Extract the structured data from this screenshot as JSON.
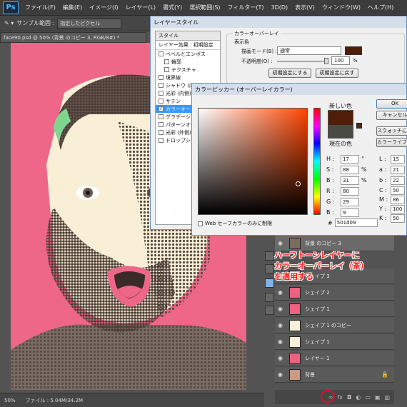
{
  "app": {
    "logo": "Ps",
    "menu": [
      "ファイル(F)",
      "編集(E)",
      "イメージ(I)",
      "レイヤー(L)",
      "書式(Y)",
      "選択範囲(S)",
      "フィルター(T)",
      "3D(D)",
      "表示(V)",
      "ウィンドウ(W)",
      "ヘルプ(H)"
    ]
  },
  "options": {
    "sample_label": "サンプル範囲 :",
    "sample_value": "指定したピクセル"
  },
  "document": {
    "tab": "face90.psd @ 50% (背景 のコピー 3, RGB/8#) *",
    "zoom": "50%",
    "file_info": "ファイル : 5.04M/34.2M"
  },
  "layer_style": {
    "title": "レイヤースタイル",
    "style_header": "スタイル",
    "preset": "レイヤー効果 : 初期設定",
    "effects": [
      {
        "label": "ベベルとエンボス",
        "checked": false
      },
      {
        "label": "輪郭",
        "checked": false
      },
      {
        "label": "テクスチャ",
        "checked": false
      },
      {
        "label": "境界線",
        "checked": false
      },
      {
        "label": "シャドウ (内側)",
        "checked": false
      },
      {
        "label": "光彩 (内側)",
        "checked": false
      },
      {
        "label": "サテン",
        "checked": false
      },
      {
        "label": "カラーオーバーレイ",
        "checked": true
      },
      {
        "label": "グラデーションオーバーレイ",
        "checked": false
      },
      {
        "label": "パターンオーバーレイ",
        "checked": false
      },
      {
        "label": "光彩 (外側)",
        "checked": false
      },
      {
        "label": "ドロップシャドウ",
        "checked": false
      }
    ],
    "group_title": "カラーオーバーレイ",
    "sub_title": "表示色",
    "blend_label": "描画モード(B) :",
    "blend_value": "通常",
    "opacity_label": "不透明度(O) :",
    "opacity_value": "100",
    "opacity_unit": "%",
    "opacity_fraction": 1.0,
    "overlay_color": "#501d09",
    "btn_default": "初期設定にする",
    "btn_reset": "初期設定に戻す"
  },
  "picker": {
    "title": "カラーピッカー (オーバーレイカラー)",
    "new_label": "新しい色",
    "current_label": "現在の色",
    "new_color": "#501d09",
    "current_color": "#4a4a44",
    "ok": "OK",
    "cancel": "キャンセル",
    "swatch": "スウォッチに追加",
    "library": "カラーライブラリ",
    "web_only": "Web セーフカラーのみに制限",
    "hex_label": "#",
    "hex": "501d09",
    "fields": [
      {
        "label": "H :",
        "value": "17",
        "unit": "°"
      },
      {
        "label": "S :",
        "value": "88",
        "unit": "%"
      },
      {
        "label": "B :",
        "value": "31",
        "unit": "%"
      },
      {
        "label": "R :",
        "value": "80",
        "unit": ""
      },
      {
        "label": "G :",
        "value": "29",
        "unit": ""
      },
      {
        "label": "B :",
        "value": "9",
        "unit": ""
      }
    ],
    "lab": [
      {
        "label": "L :",
        "value": "15"
      },
      {
        "label": "a :",
        "value": "21"
      },
      {
        "label": "b :",
        "value": "22"
      }
    ],
    "cmyk": [
      {
        "label": "C :",
        "value": "50"
      },
      {
        "label": "M :",
        "value": "86"
      },
      {
        "label": "Y :",
        "value": "100"
      },
      {
        "label": "K :",
        "value": "50"
      }
    ]
  },
  "layers": [
    {
      "name": "背景 のコピー 3",
      "thumb": "#7a6d62"
    },
    {
      "name": "シェイプ 3",
      "thumb": "#f4c7b8"
    },
    {
      "name": "シェイプ 2",
      "thumb": "#f06080"
    },
    {
      "name": "シェイプ 1",
      "thumb": "#f06080"
    },
    {
      "name": "シェイプ 1 のコピー",
      "thumb": "#f8f0d8"
    },
    {
      "name": "シェイプ 1",
      "thumb": "#f8f0d8"
    },
    {
      "name": "レイヤー 1",
      "thumb": "#f06080"
    },
    {
      "name": "背景",
      "thumb": "#c99a84"
    }
  ],
  "annotation": [
    "ハーフトーンレイヤーに",
    "カラーオーバーレイ（茶）",
    "を適用する"
  ],
  "colors": {
    "pink": "#ee6788",
    "face": "#f8efd6",
    "dots": "#5b4a43",
    "green": "#7ed68e"
  }
}
